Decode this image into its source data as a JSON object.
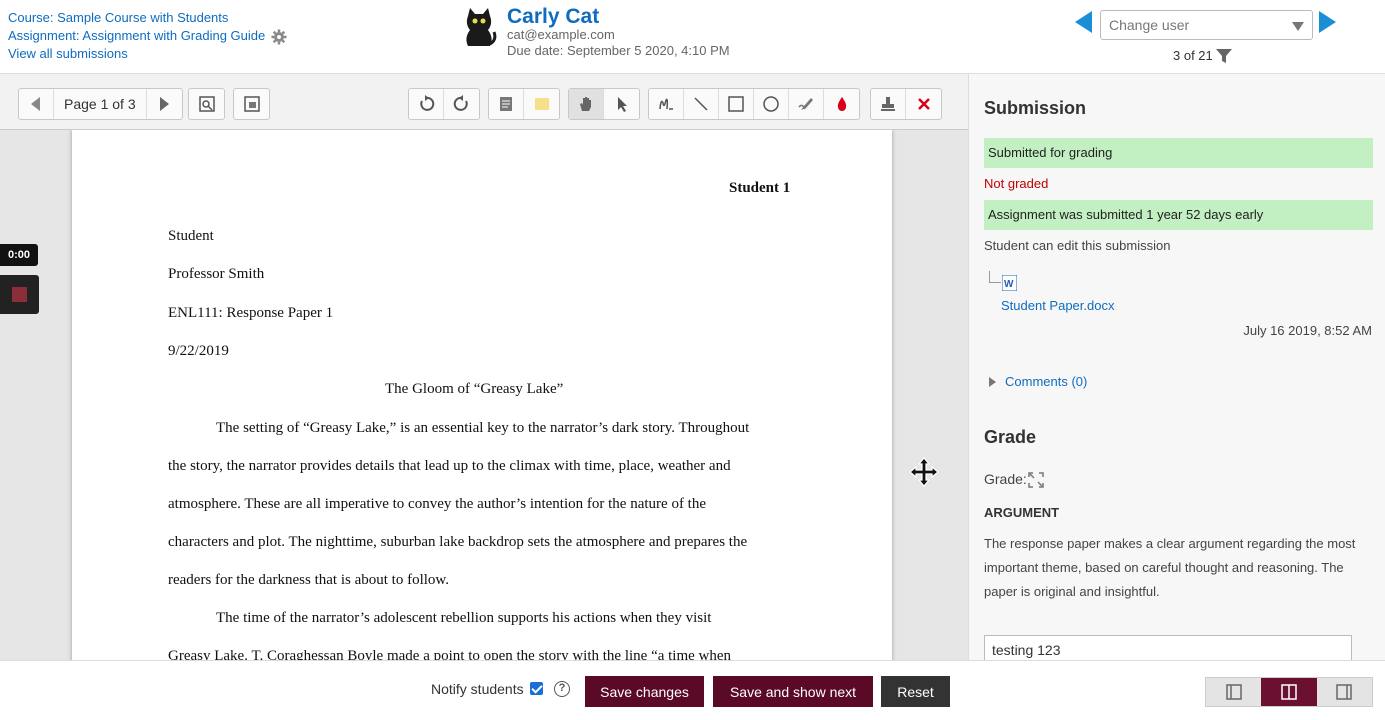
{
  "header": {
    "course_link": "Course: Sample Course with Students",
    "assignment_link": "Assignment: Assignment with Grading Guide",
    "view_all": "View all submissions",
    "user_name": "Carly Cat",
    "user_email": "cat@example.com",
    "due_date": "Due date: September 5 2020, 4:10 PM",
    "change_user_placeholder": "Change user",
    "user_count": "3 of 21"
  },
  "toolbar": {
    "page_label": "Page 1 of 3"
  },
  "document": {
    "header_right": "Student 1",
    "lines": {
      "l1": "Student",
      "l2": "Professor Smith",
      "l3": "ENL111: Response Paper 1",
      "l4": "9/22/2019",
      "title": "The Gloom of “Greasy Lake”",
      "p1a": "The setting of “Greasy Lake,” is an essential key to the narrator’s dark story. Throughout",
      "p1b": "the story, the narrator provides details that lead up to the climax with time, place, weather and",
      "p1c": "atmosphere. These are all imperative to convey the author’s intention for the nature of the",
      "p1d": "characters and plot. The nighttime, suburban lake backdrop sets the atmosphere and prepares the",
      "p1e": "readers for the darkness that is about to follow.",
      "p2a": "The time of the narrator’s adolescent rebellion supports his actions when they visit",
      "p2b": "Greasy Lake. T. Coraghessan Boyle made a point to open the story with the line “a time when"
    }
  },
  "recorder": {
    "time": "0:00"
  },
  "submission": {
    "heading": "Submission",
    "status": "Submitted for grading",
    "grading_status": "Not graded",
    "time_status": "Assignment was submitted 1 year 52 days early",
    "edit_status": "Student can edit this submission",
    "file_name": "Student Paper.docx",
    "file_date": "July 16 2019, 8:52 AM",
    "comments": "Comments (0)"
  },
  "grade": {
    "heading": "Grade",
    "label": "Grade:",
    "criterion": "ARGUMENT",
    "criterion_desc": "The response paper makes a clear argument regarding the most important theme, based on careful thought and reasoning. The paper is original and insightful.",
    "remark": "testing 123"
  },
  "footer": {
    "notify": "Notify students",
    "save": "Save changes",
    "save_next": "Save and show next",
    "reset": "Reset"
  },
  "colors": {
    "link": "#0f6cbf",
    "success_bar": "#c3f0c3",
    "not_graded": "#c00000",
    "primary_button": "#5a0a26",
    "reset_button": "#333333"
  }
}
